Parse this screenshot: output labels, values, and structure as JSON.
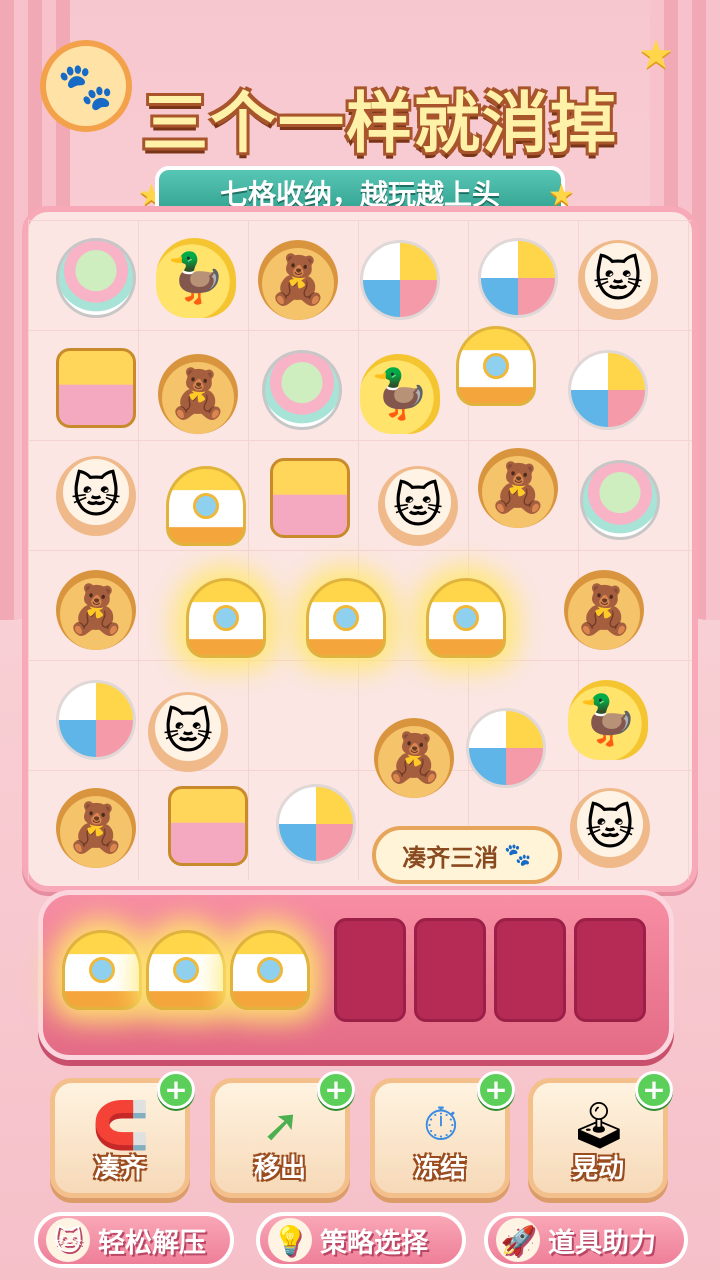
{
  "title": "三个一样就消掉",
  "subtitle": "七格收纳，越玩越上头",
  "hint_bubble": "凑齐三消",
  "board_items": [
    "lollipop",
    "duck",
    "bear",
    "ball",
    "ball",
    "cat",
    "chest",
    "bear",
    "lollipop",
    "duck",
    "rocket",
    "ball",
    "cat",
    "rocket",
    "chest",
    "cat",
    "bear",
    "lollipop",
    "bear",
    "rocket",
    "rocket",
    "rocket",
    "bear",
    "ball",
    "cat",
    "bear",
    "ball",
    "duck",
    "bear",
    "chest",
    "ball",
    "cat"
  ],
  "tray": {
    "slots_total": 7,
    "filled": [
      "rocket",
      "rocket",
      "rocket"
    ]
  },
  "tools": [
    {
      "label": "凑齐",
      "icon": "magnet-icon",
      "plus": "+"
    },
    {
      "label": "移出",
      "icon": "arrow-up-icon",
      "plus": "+"
    },
    {
      "label": "冻结",
      "icon": "stopwatch-icon",
      "plus": "+"
    },
    {
      "label": "晃动",
      "icon": "joystick-icon",
      "plus": "+"
    }
  ],
  "features": [
    {
      "label": "轻松解压",
      "icon": "cat-icon"
    },
    {
      "label": "策略选择",
      "icon": "lightbulb-icon"
    },
    {
      "label": "道具助力",
      "icon": "rocket-icon"
    }
  ]
}
